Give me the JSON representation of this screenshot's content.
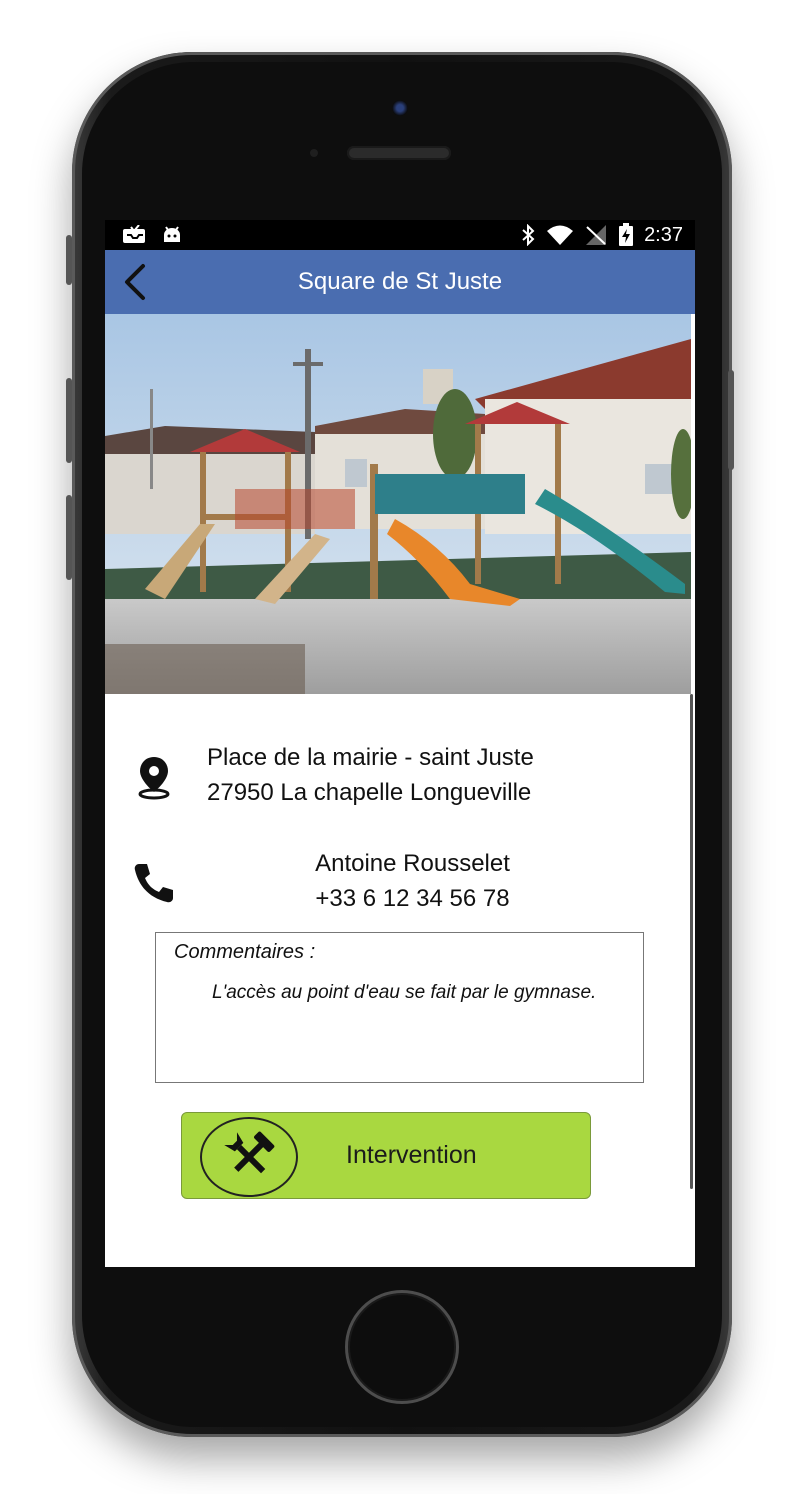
{
  "statusbar": {
    "time": "2:37",
    "icons": [
      "inbox-icon",
      "android-icon",
      "bluetooth-icon",
      "wifi-icon",
      "no-signal-icon",
      "battery-charging-icon"
    ]
  },
  "appbar": {
    "title": "Square de St Juste",
    "back_icon": "arrow-left-icon"
  },
  "location": {
    "icon": "map-pin-icon",
    "line1": "Place de la mairie - saint Juste",
    "line2": "27950 La chapelle Longueville"
  },
  "contact": {
    "icon": "phone-icon",
    "name": "Antoine Rousselet",
    "phone": "+33 6 12 34 56 78"
  },
  "comments": {
    "label": "Commentaires :",
    "text": "L'accès au point d'eau se fait par le gymnase."
  },
  "action": {
    "label": "Intervention",
    "icon": "tools-icon",
    "color": "#a9d840"
  },
  "colors": {
    "appbar": "#4a6db0"
  }
}
